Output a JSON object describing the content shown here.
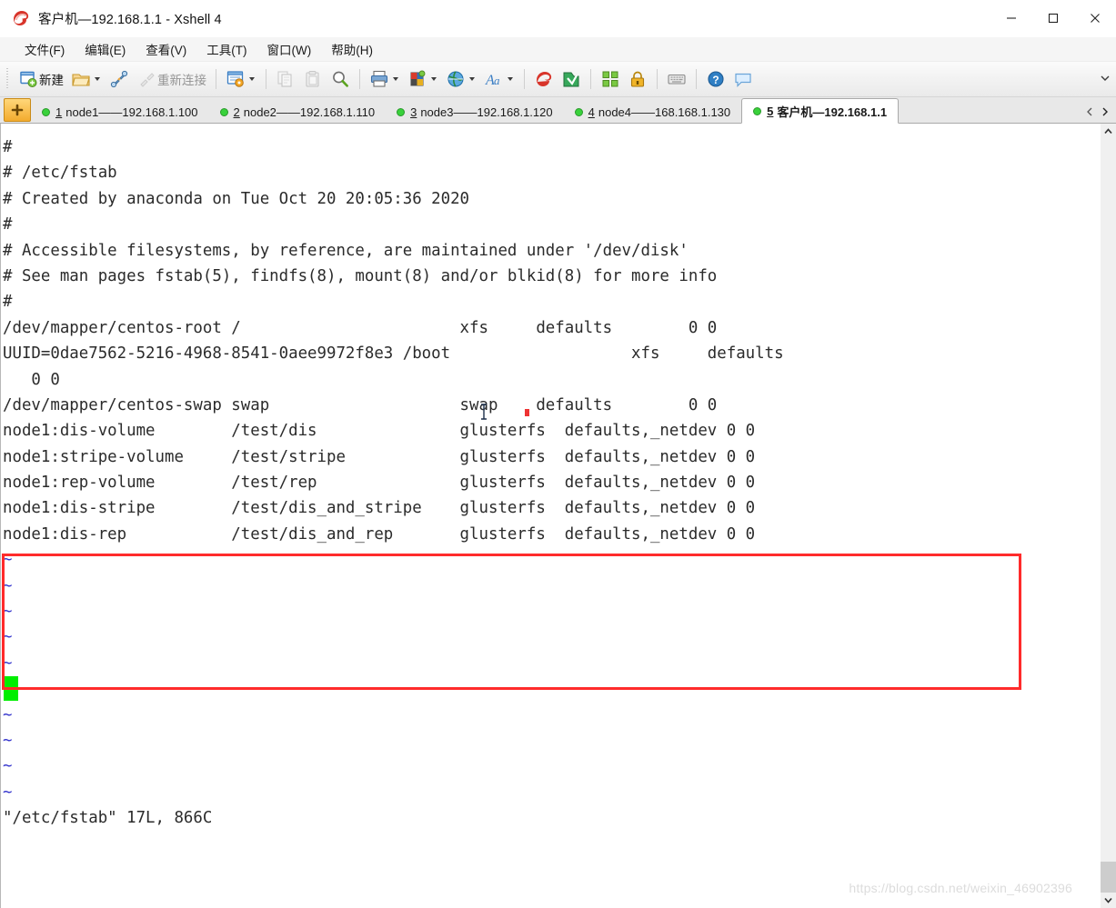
{
  "window": {
    "title": "客户机—192.168.1.1 - Xshell 4",
    "logo_icon": "xshell-logo-icon",
    "controls": [
      {
        "name": "minimize-button",
        "icon": "minimize-icon"
      },
      {
        "name": "maximize-button",
        "icon": "maximize-icon"
      },
      {
        "name": "close-button",
        "icon": "close-icon"
      }
    ]
  },
  "menubar": {
    "items": [
      {
        "label": "文件(F)",
        "name": "menu-file"
      },
      {
        "label": "编辑(E)",
        "name": "menu-edit"
      },
      {
        "label": "查看(V)",
        "name": "menu-view"
      },
      {
        "label": "工具(T)",
        "name": "menu-tools"
      },
      {
        "label": "窗口(W)",
        "name": "menu-window"
      },
      {
        "label": "帮助(H)",
        "name": "menu-help"
      }
    ]
  },
  "toolbar": {
    "new_label": "新建",
    "reconnect_label": "重新连接",
    "overflow_label": "▾"
  },
  "tabs": {
    "new_tab_label": "+",
    "items": [
      {
        "num": "1",
        "label": "node1——192.168.1.100",
        "active": false
      },
      {
        "num": "2",
        "label": "node2——192.168.1.110",
        "active": false
      },
      {
        "num": "3",
        "label": "node3——192.168.1.120",
        "active": false
      },
      {
        "num": "4",
        "label": "node4——168.168.1.130",
        "active": false
      },
      {
        "num": "5",
        "label": "客户机—192.168.1.1",
        "active": true
      }
    ],
    "nav_prev": "‹",
    "nav_next": "›"
  },
  "terminal": {
    "lines": [
      "#",
      "# /etc/fstab",
      "# Created by anaconda on Tue Oct 20 20:05:36 2020",
      "#",
      "# Accessible filesystems, by reference, are maintained under '/dev/disk'",
      "# See man pages fstab(5), findfs(8), mount(8) and/or blkid(8) for more info",
      "#",
      "/dev/mapper/centos-root /                       xfs     defaults        0 0",
      "UUID=0dae7562-5216-4968-8541-0aee9972f8e3 /boot                   xfs     defaults",
      "   0 0",
      "/dev/mapper/centos-swap swap                    swap    defaults        0 0",
      "node1:dis-volume        /test/dis               glusterfs  defaults,_netdev 0 0",
      "node1:stripe-volume     /test/stripe            glusterfs  defaults,_netdev 0 0",
      "node1:rep-volume        /test/rep               glusterfs  defaults,_netdev 0 0",
      "node1:dis-stripe        /test/dis_and_stripe    glusterfs  defaults,_netdev 0 0",
      "node1:dis-rep           /test/dis_and_rep       glusterfs  defaults,_netdev 0 0"
    ],
    "tilde_char": "~",
    "tilde_count": 10,
    "status_line": "\"/etc/fstab\" 17L, 866C",
    "cursor_color": "#00ee00",
    "highlight_color": "#ff2b2b"
  },
  "watermark": {
    "text": "https://blog.csdn.net/weixin_46902396"
  },
  "scrollbar": {
    "up_arrow": "▲",
    "down_arrow": "▼"
  }
}
